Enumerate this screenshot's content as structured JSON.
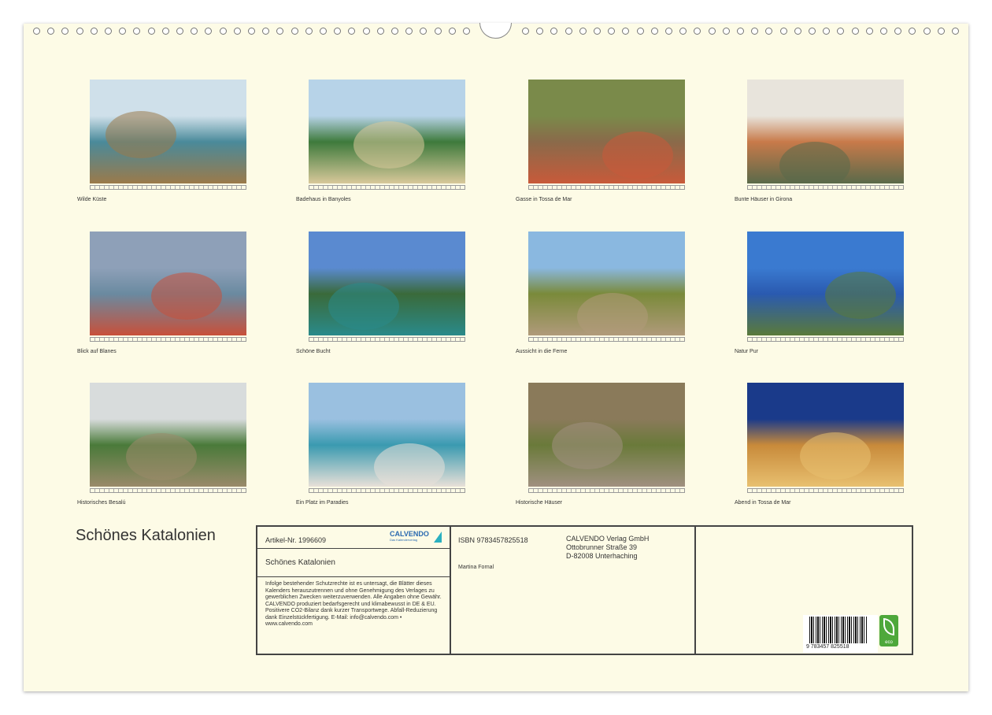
{
  "calendar_title": "Schönes Katalonien",
  "photos": [
    {
      "caption": "Wilde Küste",
      "sky": "#cfe0ea",
      "main": "#4a8a9a",
      "accent": "#9b7a4a"
    },
    {
      "caption": "Badehaus in Banyoles",
      "sky": "#b7d3e8",
      "main": "#3e7a3c",
      "accent": "#d8c89a"
    },
    {
      "caption": "Gasse in Tossa de Mar",
      "sky": "#7a8a4a",
      "main": "#8a6a4a",
      "accent": "#c85a3a"
    },
    {
      "caption": "Bunte Häuser in Girona",
      "sky": "#e8e4dc",
      "main": "#c87a4a",
      "accent": "#5a6a4a"
    },
    {
      "caption": "Blick auf Blanes",
      "sky": "#8ea0b8",
      "main": "#6a8aa0",
      "accent": "#c8503a"
    },
    {
      "caption": "Schöne Bucht",
      "sky": "#5a8ad0",
      "main": "#3a6a3a",
      "accent": "#2a8a8a"
    },
    {
      "caption": "Aussicht in die Ferne",
      "sky": "#8ab8e0",
      "main": "#7a8a3a",
      "accent": "#b09a7a"
    },
    {
      "caption": "Natur Pur",
      "sky": "#3a7ad0",
      "main": "#2a5ab0",
      "accent": "#5a7a3a"
    },
    {
      "caption": "Historisches Besalú",
      "sky": "#d8dcdc",
      "main": "#4a7a3a",
      "accent": "#9a8a6a"
    },
    {
      "caption": "Ein Platz im Paradies",
      "sky": "#9ac0e0",
      "main": "#3a9ab0",
      "accent": "#e8e0d8"
    },
    {
      "caption": "Historische Häuser",
      "sky": "#8a7a5a",
      "main": "#6a7a3a",
      "accent": "#a09080"
    },
    {
      "caption": "Abend in Tossa de Mar",
      "sky": "#1a3a8a",
      "main": "#c88a3a",
      "accent": "#e8c070"
    }
  ],
  "info": {
    "artikel": "Artikel-Nr. 1996609",
    "brand": "CALVENDO",
    "brand_sub": "Das Kalenderverlag",
    "title": "Schönes Katalonien",
    "legal": "Infolge bestehender Schutzrechte ist es untersagt, die Blätter dieses Kalenders herauszutrennen und ohne Genehmigung des Verlages zu gewerblichen Zwecken weiterzuverwenden. Alle Angaben ohne Gewähr. CALVENDO produziert bedarfsgerecht und klimabewusst in DE & EU. Positivere CO2-Bilanz dank kurzer Transportwege. Abfall-Reduzierung dank Einzelstückfertigung. E-Mail: info@calvendo.com • www.calvendo.com",
    "isbn": "ISBN 9783457825518",
    "author": "Martina Fornal",
    "publisher": [
      "CALVENDO Verlag GmbH",
      "Ottobrunner Straße 39",
      "D-82008 Unterhaching"
    ],
    "barcode_text": "9 783457 825518",
    "eco_label": "eco"
  }
}
